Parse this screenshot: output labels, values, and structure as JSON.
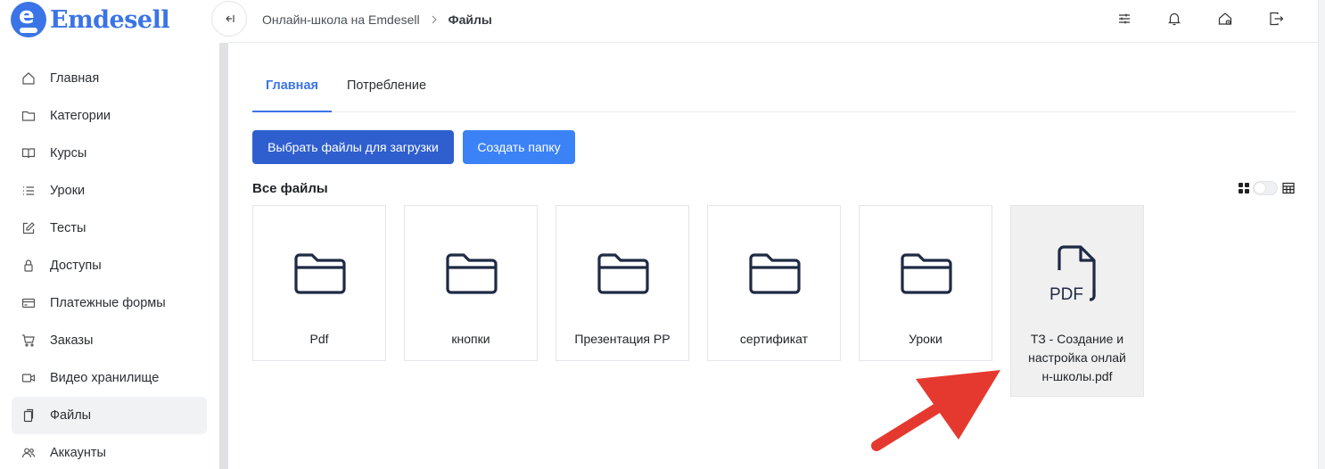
{
  "logo": {
    "text": "Emdesell",
    "badge_letter": "e"
  },
  "sidebar": {
    "items": [
      {
        "label": "Главная",
        "icon": "home-icon"
      },
      {
        "label": "Категории",
        "icon": "folder-icon"
      },
      {
        "label": "Курсы",
        "icon": "book-icon"
      },
      {
        "label": "Уроки",
        "icon": "list-icon"
      },
      {
        "label": "Тесты",
        "icon": "edit-icon"
      },
      {
        "label": "Доступы",
        "icon": "lock-icon"
      },
      {
        "label": "Платежные формы",
        "icon": "credit-card-icon"
      },
      {
        "label": "Заказы",
        "icon": "cart-icon"
      },
      {
        "label": "Видео хранилище",
        "icon": "video-icon"
      },
      {
        "label": "Файлы",
        "icon": "files-icon",
        "active": true
      },
      {
        "label": "Аккаунты",
        "icon": "users-icon"
      }
    ]
  },
  "breadcrumb": {
    "parent": "Онлайн-школа на Emdesell",
    "current": "Файлы"
  },
  "topbar": {
    "icons": [
      "sliders-icon",
      "bell-icon",
      "home-settings-icon",
      "logout-icon"
    ]
  },
  "tabs": [
    {
      "label": "Главная",
      "active": true
    },
    {
      "label": "Потребление",
      "active": false
    }
  ],
  "actions": {
    "upload_label": "Выбрать файлы для загрузки",
    "create_folder_label": "Создать папку"
  },
  "files_section": {
    "title": "Все файлы",
    "view": "grid"
  },
  "files": [
    {
      "name": "Pdf",
      "type": "folder"
    },
    {
      "name": "кнопки",
      "type": "folder"
    },
    {
      "name": "Презентация PP",
      "type": "folder"
    },
    {
      "name": "сертификат",
      "type": "folder"
    },
    {
      "name": "Уроки",
      "type": "folder"
    },
    {
      "name": "ТЗ - Создание и настройка онлайн-школы.pdf",
      "name_lines": [
        "ТЗ - Создание и",
        "настройка онлай",
        "н-школы.pdf"
      ],
      "type": "pdf",
      "icon_label": "PDF",
      "selected": true
    }
  ],
  "colors": {
    "accent": "#3b74e6",
    "primary_button": "#2f5fcf",
    "secondary_button": "#3b82f6",
    "annotation_arrow": "#e5392f",
    "icon_dark": "#1f2a44"
  }
}
